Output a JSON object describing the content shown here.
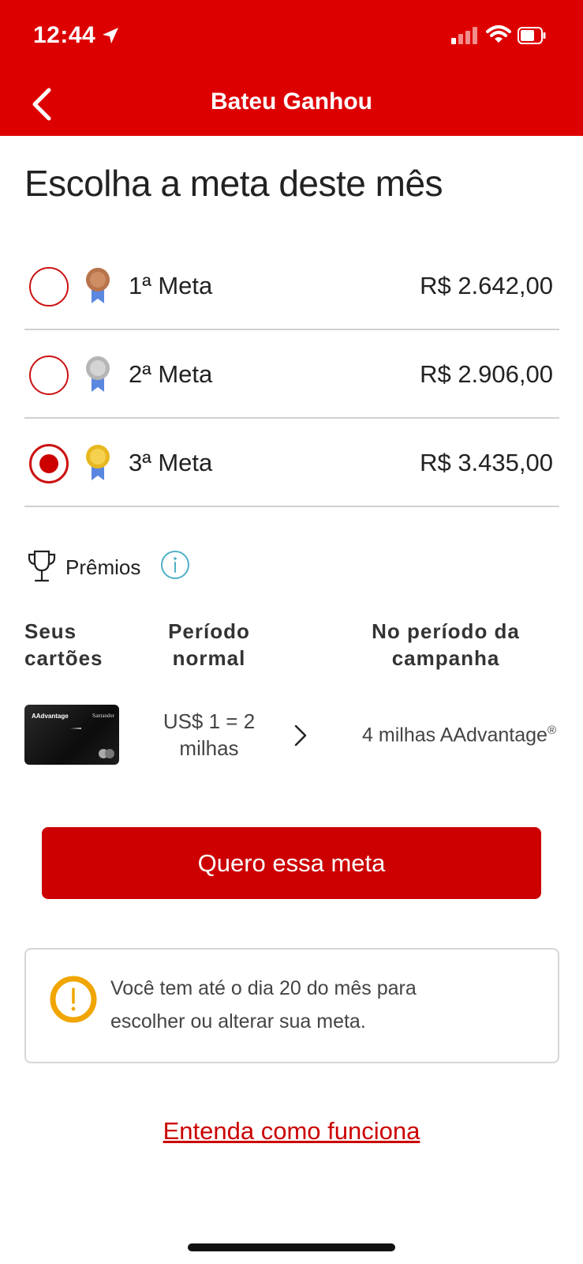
{
  "status_bar": {
    "time": "12:44"
  },
  "header": {
    "title": "Bateu Ganhou",
    "background": "#dd0000"
  },
  "page_title": "Escolha a meta deste mês",
  "goals": [
    {
      "label": "1ª Meta",
      "value": "R$ 2.642,00",
      "medal": "bronze-medal-icon",
      "selected": false
    },
    {
      "label": "2ª Meta",
      "value": "R$ 2.906,00",
      "medal": "silver-medal-icon",
      "selected": false
    },
    {
      "label": "3ª Meta",
      "value": "R$ 3.435,00",
      "medal": "gold-medal-icon",
      "selected": true
    }
  ],
  "prizes": {
    "label": "Prêmios",
    "columns": {
      "cards_line1": "Seus",
      "cards_line2": "cartões",
      "normal_line1": "Período",
      "normal_line2": "normal",
      "campaign_line1": "No período da",
      "campaign_line2": "campanha"
    },
    "card_brand": "AAdvantage",
    "card_issuer": "Santander",
    "normal_rate_line1": "US$ 1 = 2",
    "normal_rate_line2": "milhas",
    "campaign_rate": "4 milhas AAdvantage",
    "campaign_rate_mark": "®"
  },
  "cta_label": "Quero essa meta",
  "notice": {
    "line1": "Você tem até o dia 20 do mês para",
    "line2": "escolher ou alterar sua meta."
  },
  "help_link": "Entenda como funciona",
  "colors": {
    "brand_red": "#cc0000",
    "warning": "#f0a500",
    "info": "#4fb0c6"
  }
}
